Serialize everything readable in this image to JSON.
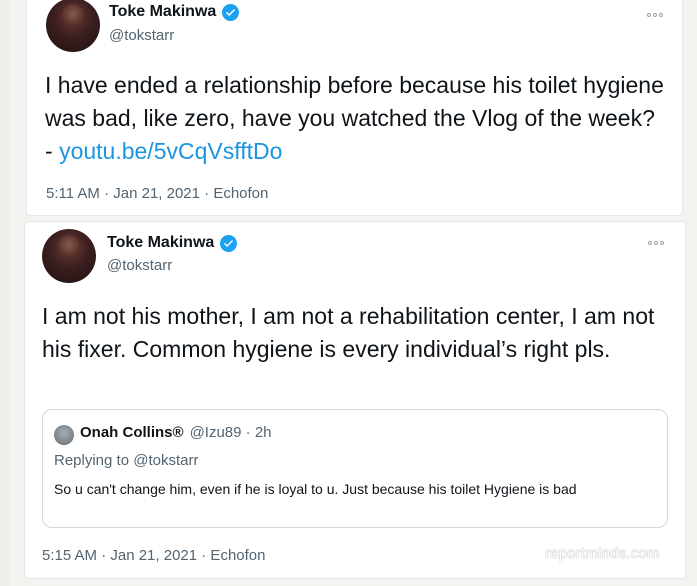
{
  "tweets": [
    {
      "author_name": "Toke Makinwa",
      "author_handle": "@tokstarr",
      "text": "I have ended a relationship before because his toilet hygiene was bad, like zero, have you watched the Vlog of the week? - ",
      "link_text": "youtu.be/5vCqVsfftDo",
      "meta": "5:11 AM · Jan 21, 2021 · Echofon",
      "more_icon": "more-dots-icon",
      "verified_icon": "verified-badge-icon"
    },
    {
      "author_name": "Toke Makinwa",
      "author_handle": "@tokstarr",
      "text": "I am not his mother, I am not a rehabilitation center, I am not his fixer. Common hygiene is every individual’s right pls.",
      "meta": "5:15 AM · Jan 21, 2021 · Echofon",
      "more_icon": "more-dots-icon",
      "verified_icon": "verified-badge-icon",
      "quoted": {
        "author_name": "Onah Collins®",
        "author_handle": "@Izu89 · 2h",
        "replying_to": "Replying to @tokstarr",
        "text": "So u can't change him, even if he is loyal to u. Just because his toilet Hygiene is bad"
      }
    }
  ],
  "watermark": "reportminds.com",
  "colors": {
    "link": "#1b95e0",
    "verified": "#1da1f2",
    "muted_text": "#536471",
    "card_background": "#ffffff",
    "page_background": "#f3f4ef"
  }
}
